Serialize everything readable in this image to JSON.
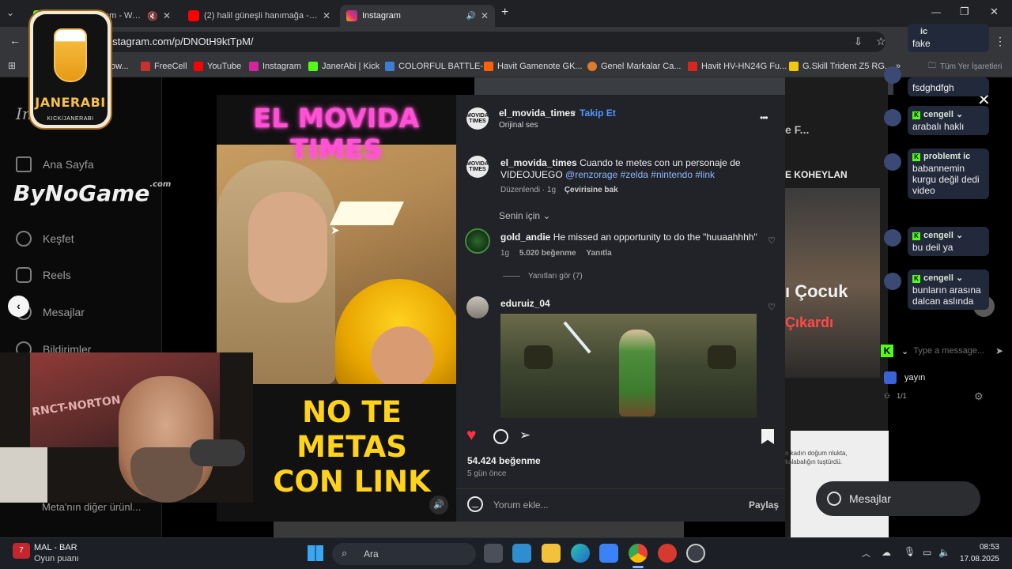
{
  "browser": {
    "tabs": [
      {
        "title": "am - Watch Li",
        "active": false
      },
      {
        "title": "(2) halil güneşli hanımağa - You",
        "active": false
      },
      {
        "title": "Instagram",
        "active": true
      }
    ],
    "new_tab": "+",
    "url": "instagram.com/p/DNOtH9ktTpM/",
    "bookmarks": [
      "ow...",
      "FreeCell",
      "YouTube",
      "Instagram",
      "JanerAbi | Kick",
      "COLORFUL BATTLE-...",
      "Havit Gamenote GK...",
      "Genel Markalar Ca...",
      "Havit HV-HN24G Fu...",
      "G.Skill Trident Z5 RG...",
      "»",
      "Tüm Yer İşaretleri"
    ],
    "colors": {
      "chrome_dark": "#202124",
      "chrome": "#35363a"
    }
  },
  "instagram_sidebar": {
    "items": [
      {
        "label": "Ana Sayfa",
        "icon": "home-icon"
      },
      {
        "label": "Keşfet",
        "icon": "compass-icon"
      },
      {
        "label": "Reels",
        "icon": "reels-icon"
      },
      {
        "label": "Mesajlar",
        "icon": "messenger-icon"
      },
      {
        "label": "Bildirimler",
        "icon": "heart-icon"
      }
    ],
    "footer": "Meta'nın diğer ürünl..."
  },
  "reel": {
    "title_overlay": "EL MOVIDA TIMES",
    "caption_overlay_line1": "NO TE METAS",
    "caption_overlay_line2": "CON LINK"
  },
  "post": {
    "author": "el_movida_times",
    "author_avatar_text": "MOVIDA TIMES",
    "follow_label": "Takip Et",
    "audio": "Orijinal ses",
    "more_label": "•••",
    "caption_text": "Cuando te metes con un personaje de VIDEOJUEGO",
    "caption_tags": "@renzorage #zelda #nintendo #link",
    "caption_meta": "Düzenlendi · 1g",
    "translate_label": "Çevirisine bak",
    "sort_label": "Senin için",
    "comments": [
      {
        "user": "gold_andie",
        "text": "He missed an opportunity to do the \"huuaahhhh\"",
        "age": "1g",
        "likes": "5.020 beğenme",
        "reply": "Yanıtla",
        "replies_label": "Yanıtları gör (7)"
      },
      {
        "user": "eduruiz_04",
        "text": ""
      }
    ],
    "likes": "54.424 beğenme",
    "date": "5 gün önce",
    "comment_placeholder": "Yorum ekle...",
    "share_label": "Paylaş",
    "colors": {
      "panel": "#212328",
      "link": "#4f98ff",
      "like": "#ff3040"
    }
  },
  "stream_overlay": {
    "logo_name": "JANERABI",
    "logo_sub": "KICK/JANERABI",
    "sponsor": "ByNoGame",
    "sponsor_suffix": ".com",
    "webcam_poster": "RNCT-NORTON"
  },
  "background_feed": {
    "snippet1": "e F...",
    "snippet2": "E KOHEYLAN",
    "snippet3": "ı Çocuk",
    "snippet4": "Çıkardı",
    "snippet5": "n kadın doğum nlukta, kalabalığın tuştürdü.",
    "messages_label": "Mesajlar"
  },
  "chat": {
    "messages": [
      {
        "user": "ic",
        "text": "fake"
      },
      {
        "user": "",
        "text": "fsdghdfgh"
      },
      {
        "user": "cengell",
        "text": "arabalı haklı"
      },
      {
        "user": "problemt ic",
        "text": "babannemin kurgu değil dedi video"
      },
      {
        "user": "cengell",
        "text": "bu deil ya"
      },
      {
        "user": "cengell",
        "text": "bunların arasına dalcan aslında"
      }
    ],
    "input_placeholder": "Type a message...",
    "viewer_name": "yayın",
    "viewer_count": "1/1"
  },
  "taskbar": {
    "weather_value": "7",
    "weather_title": "MAL - BAR",
    "weather_sub": "Oyun puanı",
    "search_placeholder": "Ara",
    "time": "08:53",
    "date": "17.08.2025"
  }
}
